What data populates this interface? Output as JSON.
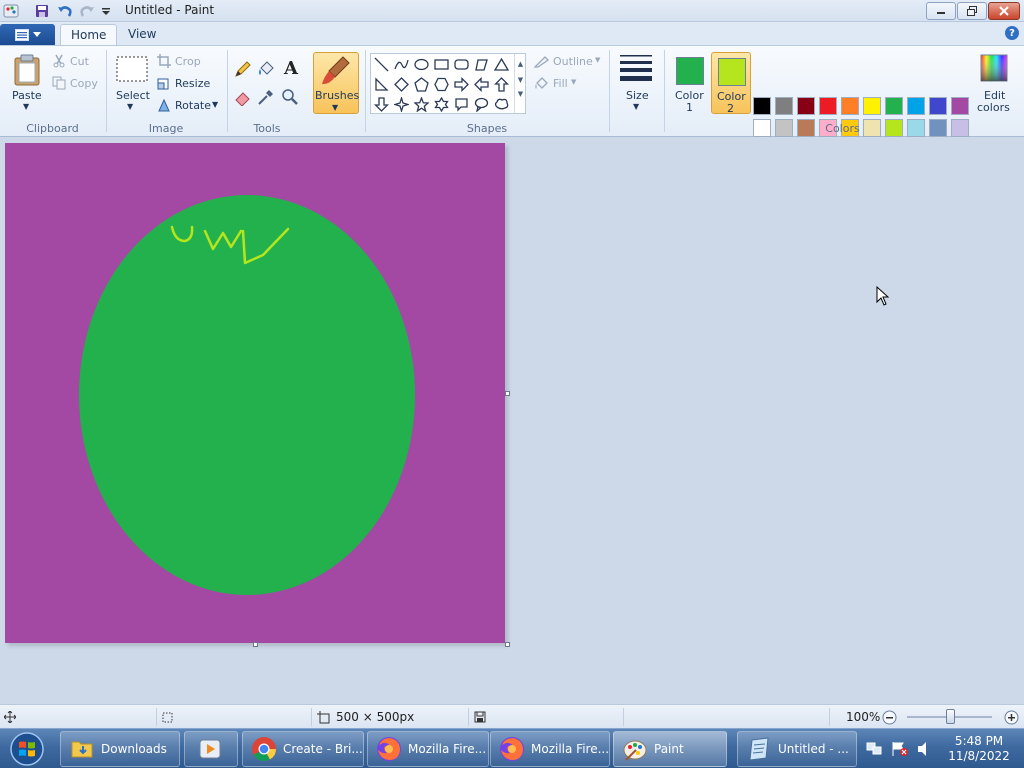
{
  "window": {
    "title": "Untitled - Paint"
  },
  "tabs": {
    "home": "Home",
    "view": "View"
  },
  "help": {
    "label": "?"
  },
  "ribbon": {
    "clipboard": {
      "label": "Clipboard",
      "paste": "Paste",
      "cut": "Cut",
      "copy": "Copy"
    },
    "image": {
      "label": "Image",
      "select": "Select",
      "crop": "Crop",
      "resize": "Resize",
      "rotate": "Rotate"
    },
    "tools": {
      "label": "Tools",
      "text_glyph": "A"
    },
    "brushes": {
      "label": "Brushes"
    },
    "shapes": {
      "label": "Shapes",
      "outline": "Outline",
      "fill": "Fill"
    },
    "size": {
      "label": "Size"
    },
    "colors": {
      "label": "Colors",
      "color1_label": "Color 1",
      "color1_line1": "Color",
      "color1_line2": "1",
      "color2_line1": "Color",
      "color2_line2": "2",
      "color1": "#22b14c",
      "color2": "#b5e61d",
      "edit_line1": "Edit",
      "edit_line2": "colors",
      "palette_row1": [
        "#000000",
        "#7f7f7f",
        "#880015",
        "#ed1c24",
        "#ff7f27",
        "#fff200",
        "#22b14c",
        "#00a2e8",
        "#3f48cc",
        "#a349a4"
      ],
      "palette_row2": [
        "#ffffff",
        "#c3c3c3",
        "#b97a57",
        "#ffaec9",
        "#ffc90e",
        "#efe4b0",
        "#b5e61d",
        "#99d9ea",
        "#7092be",
        "#c8bfe7"
      ]
    }
  },
  "canvas": {
    "background": "#a349a4",
    "ellipse_color": "#22b14c",
    "scribble_color": "#b5e61d"
  },
  "statusbar": {
    "dimensions": "500 × 500px",
    "zoom": "100%"
  },
  "taskbar": {
    "items": [
      {
        "label": "Downloads"
      },
      {
        "label": "Create - Bri..."
      },
      {
        "label": "Mozilla Fire..."
      },
      {
        "label": "Mozilla Fire..."
      },
      {
        "label": "Paint"
      },
      {
        "label": "Untitled - ..."
      }
    ],
    "time": "5:48 PM",
    "date": "11/8/2022"
  }
}
